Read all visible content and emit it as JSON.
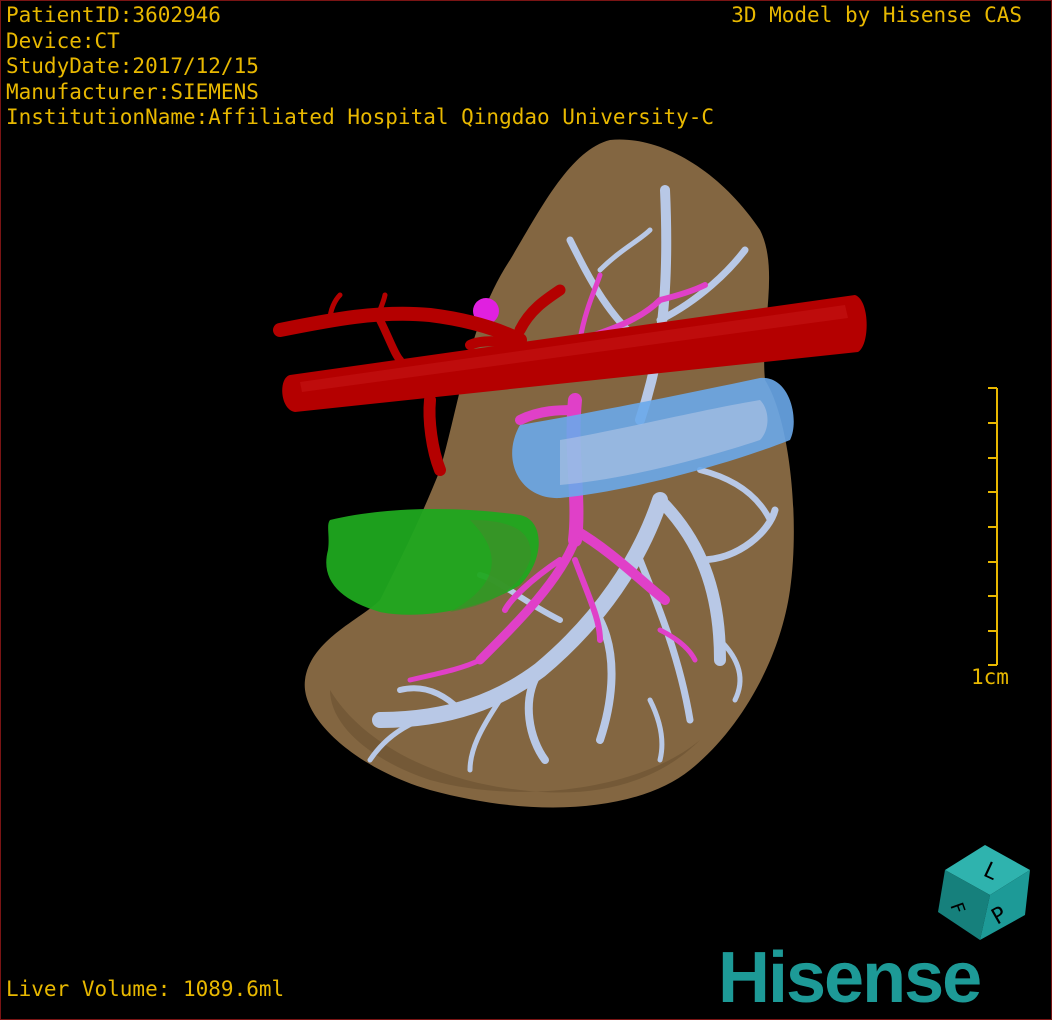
{
  "header": {
    "patient_id": "PatientID:3602946",
    "device": "Device:CT",
    "study_date": "StudyDate:2017/12/15",
    "manufacturer": "Manufacturer:SIEMENS",
    "institution": "InstitutionName:Affiliated Hospital Qingdao University-C"
  },
  "credit": "3D Model by Hisense CAS",
  "scale_bar": {
    "label": "1cm"
  },
  "footer": {
    "liver_volume": "Liver Volume: 1089.6ml"
  },
  "orientation_cube": {
    "faces": [
      "L",
      "P",
      "F"
    ]
  },
  "logo": "Hisense",
  "colors": {
    "text": "#e8b800",
    "liver": "#8a6b45",
    "aorta": "#b40000",
    "portal_vein": "#e040c8",
    "hepatic_vein": "#b8c8e6",
    "vena_cava": "#6aa8ea",
    "tumor": "#1fa81f",
    "cube": "#1d9a97",
    "logo": "#1d9a97"
  }
}
